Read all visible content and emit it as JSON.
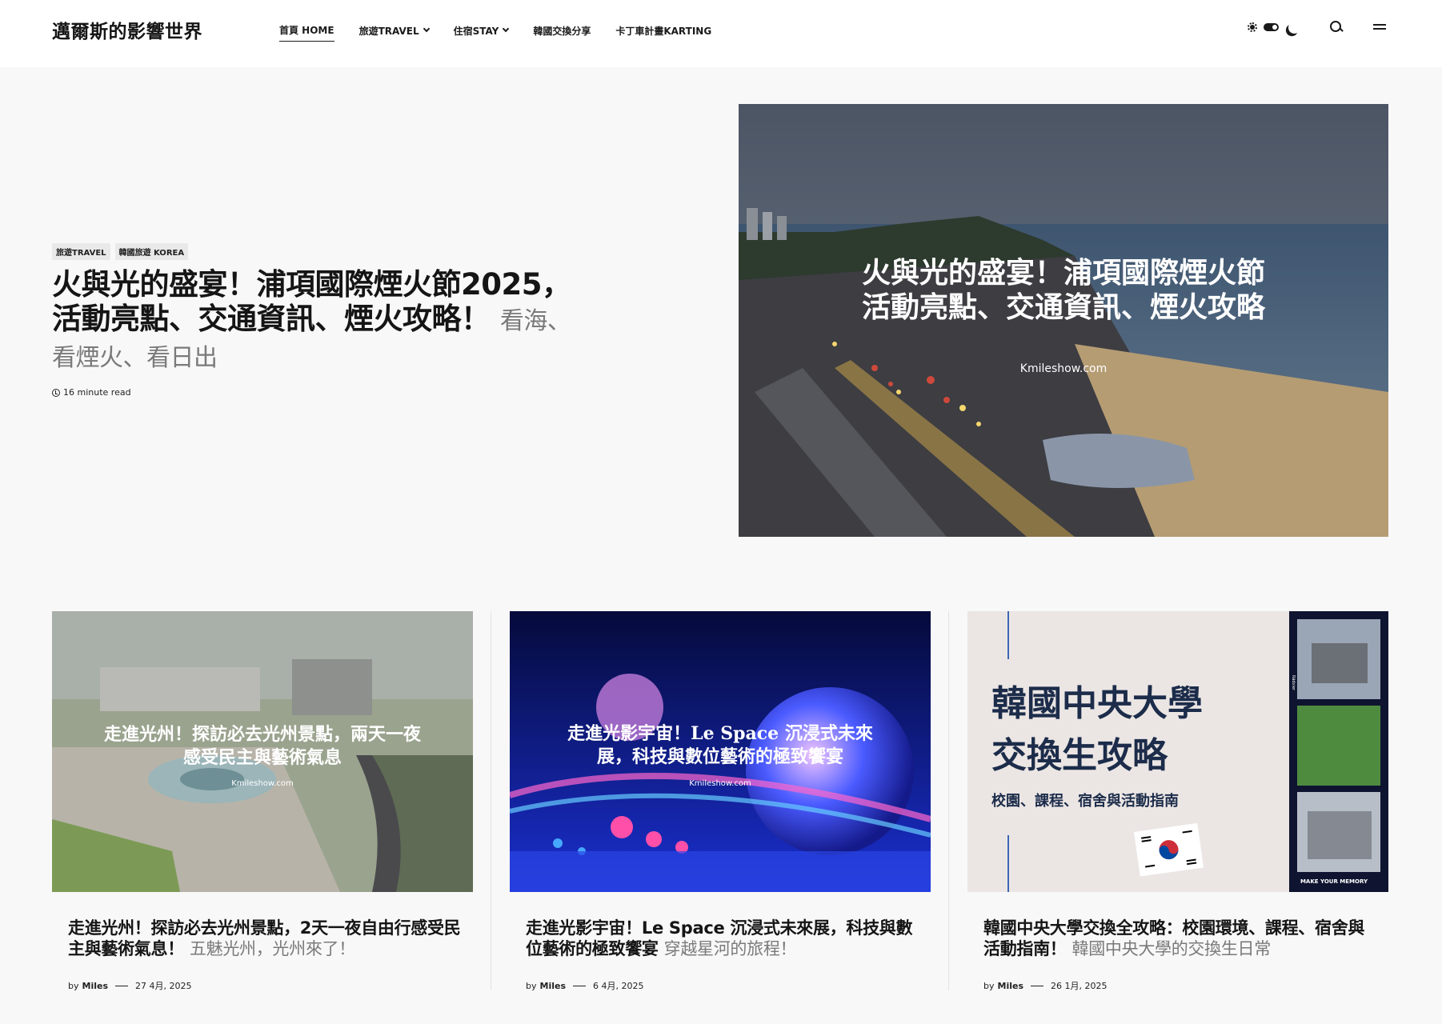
{
  "site": {
    "title": "邁爾斯的影響世界"
  },
  "nav": [
    {
      "label": "首頁 HOME",
      "active": true,
      "dropdown": false
    },
    {
      "label": "旅遊TRAVEL",
      "active": false,
      "dropdown": true
    },
    {
      "label": "住宿STAY",
      "active": false,
      "dropdown": true
    },
    {
      "label": "韓國交換分享",
      "active": false,
      "dropdown": false
    },
    {
      "label": "卡丁車計畫KARTING",
      "active": false,
      "dropdown": false
    }
  ],
  "header_tools": {
    "theme_light_icon": "sun-icon",
    "theme_toggle": "toggle",
    "theme_dark_icon": "moon-icon",
    "search_icon": "search-icon",
    "menu_icon": "menu-icon"
  },
  "hero": {
    "tags": [
      "旅遊TRAVEL",
      "韓國旅遊 KOREA"
    ],
    "title": "火與光的盛宴！浦項國際煙火節2025，活動亮點、交通資訊、煙火攻略！",
    "subtitle": "看海、看煙火、看日出",
    "read_time": "16 minute read",
    "image": {
      "overlay_line1": "火與光的盛宴！浦項國際煙火節",
      "overlay_line2": "活動亮點、交通資訊、煙火攻略",
      "watermark": "Kmileshow.com"
    }
  },
  "posts": [
    {
      "title": "走進光州！探訪必去光州景點，2天一夜自由行感受民主與藝術氣息！",
      "subtitle": "五魅光州，光州來了！",
      "author_prefix": "by",
      "author": "Miles",
      "date": "27 4月, 2025",
      "image": {
        "overlay_line1": "走進光州！探訪必去光州景點，兩天一夜",
        "overlay_line2": "感受民主與藝術氣息",
        "watermark": "Kmileshow.com"
      }
    },
    {
      "title": "走進光影宇宙！Le Space 沉浸式未來展，科技與數位藝術的極致饗宴",
      "subtitle": "穿越星河的旅程！",
      "author_prefix": "by",
      "author": "Miles",
      "date": "6 4月, 2025",
      "image": {
        "overlay_line1": "走進光影宇宙！Le Space 沉浸式未來",
        "overlay_line2": "展，科技與數位藝術的極致饗宴",
        "watermark": "Kmileshow.com"
      }
    },
    {
      "title": "韓國中央大學交換全攻略：校園環境、課程、宿舍與活動指南！",
      "subtitle": "韓國中央大學的交換生日常",
      "author_prefix": "by",
      "author": "Miles",
      "date": "26 1月, 2025",
      "image": {
        "heading_line1": "韓國中央大學",
        "heading_line2": "交換生攻略",
        "caption": "校園、課程、宿舍與活動指南",
        "side_label": "MAKE YOUR MEMORY",
        "side_small": "Rädxier"
      }
    }
  ],
  "colors": {
    "background": "#f8f8f8",
    "header": "#ffffff",
    "text": "#151515",
    "muted": "#7a7a7a",
    "tag_bg": "#e9e9e9"
  }
}
